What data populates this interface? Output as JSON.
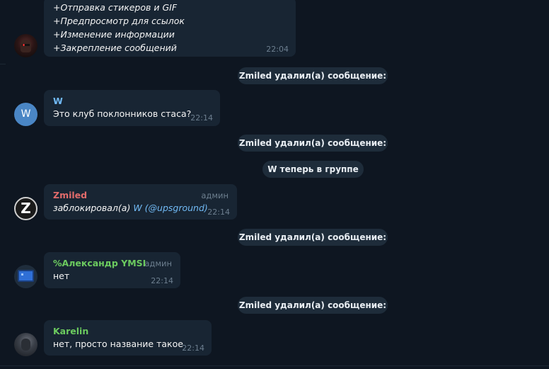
{
  "messages": {
    "first": {
      "lines": [
        "+Отправка стикеров и GIF",
        "+Предпросмотр для ссылок",
        "+Изменение информации",
        "+Закрепление сообщений"
      ],
      "time": "22:04"
    },
    "w": {
      "sender": "W",
      "avatar_letter": "W",
      "text": "Это клуб поклонников стаса?",
      "time": "22:14"
    },
    "zmiled": {
      "sender": "Zmiled",
      "role": "админ",
      "avatar_letter": "Z",
      "text_prefix": "заблокировал(а) ",
      "user": "W",
      "handle": "(@upsground)",
      "time": "22:14"
    },
    "alexander": {
      "sender": "%Александр YMSI",
      "role": "админ",
      "text": "нет",
      "time": "22:14"
    },
    "karelin": {
      "sender": "Karelin",
      "text": "нет, просто название такое",
      "time": "22:14"
    }
  },
  "service": {
    "deleted1": "Zmiled удалил(а) сообщение:",
    "deleted2": "Zmiled удалил(а) сообщение:",
    "joined": "W теперь в группе",
    "deleted3": "Zmiled удалил(а) сообщение:",
    "deleted4": "Zmiled удалил(а) сообщение:"
  },
  "colors": {
    "background": "#0e1621",
    "bubble": "#182533",
    "w_name": "#71baf5",
    "zmiled_name": "#e16b6b",
    "alexander_name": "#6ccb5f",
    "karelin_name": "#6ccb5f"
  }
}
